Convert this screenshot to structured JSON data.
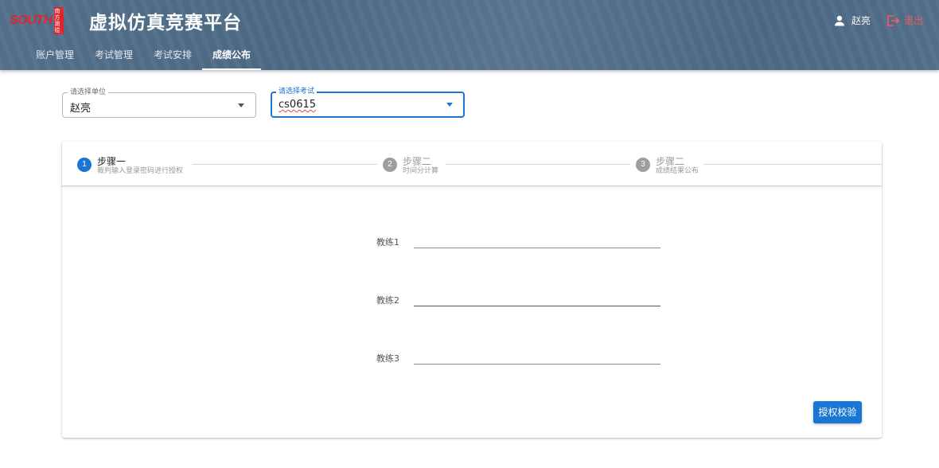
{
  "header": {
    "logo_text": "SOUTH",
    "logo_cn": "南方测绘",
    "title": "虚拟仿真竞赛平台",
    "user_name": "赵亮",
    "logout_label": "退出",
    "nav": [
      "账户管理",
      "考试管理",
      "考试安排",
      "成绩公布"
    ],
    "active_nav": "成绩公布"
  },
  "filters": {
    "unit_label": "请选择单位",
    "unit_value": "赵亮",
    "exam_label": "请选择考试",
    "exam_value": "cs0615"
  },
  "stepper": {
    "steps": [
      {
        "number": "1",
        "title": "步骤一",
        "subtitle": "裁判输入登录密码进行授权",
        "active": true
      },
      {
        "number": "2",
        "title": "步骤二",
        "subtitle": "时间分计算",
        "active": false
      },
      {
        "number": "3",
        "title": "步骤二",
        "subtitle": "成绩结果公布",
        "active": false
      }
    ]
  },
  "form": {
    "fields": [
      {
        "label": "教练1",
        "value": ""
      },
      {
        "label": "教练2",
        "value": ""
      },
      {
        "label": "教练3",
        "value": ""
      }
    ],
    "submit_label": "授权校验"
  },
  "colors": {
    "primary": "#1976d2",
    "header": "#4f6c87",
    "logout": "#f05a5a",
    "inactive_step": "#9e9e9e"
  }
}
